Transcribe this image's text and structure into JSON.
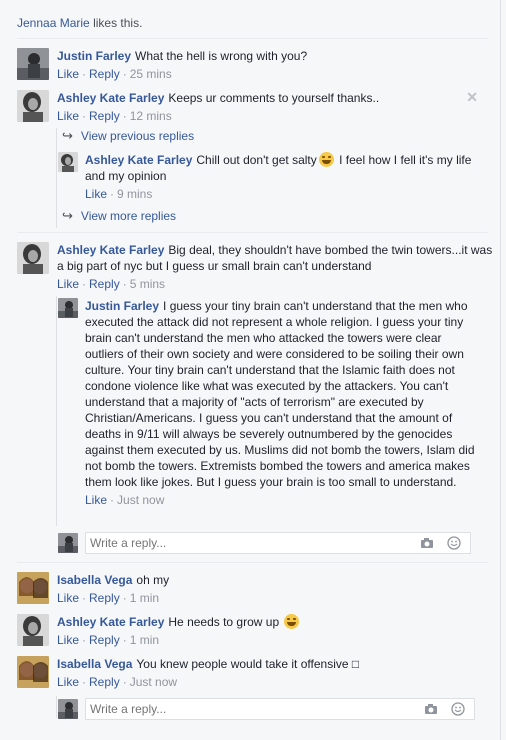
{
  "likes": {
    "name": "Jennaa Marie",
    "suffix": "likes this."
  },
  "actions": {
    "like": "Like",
    "reply": "Reply",
    "dot": "·"
  },
  "links": {
    "view_previous": "View previous replies",
    "view_more": "View more replies"
  },
  "reply_box": {
    "placeholder": "Write a reply..."
  },
  "comments": [
    {
      "author": "Justin Farley",
      "text": "What the hell is wrong with you?",
      "time": "25 mins",
      "avatar": "justin"
    },
    {
      "author": "Ashley Kate Farley",
      "text": "Keeps ur comments to yourself thanks..",
      "time": "12 mins",
      "avatar": "ashley"
    },
    {
      "author": "Ashley Kate Farley",
      "text": "Chill out don't get salty",
      "text2": "I feel how I fell it's my life and my opinion",
      "time": "9 mins",
      "avatar": "ashley",
      "emoji": "grimace-emoji"
    },
    {
      "author": "Ashley Kate Farley",
      "text": "Big deal, they shouldn't have bombed the twin towers...it was a big part of nyc but I guess ur small brain can't understand",
      "time": "5 mins",
      "avatar": "ashley"
    },
    {
      "author": "Justin Farley",
      "text": "I guess your tiny brain can't understand that the men who executed the attack did not represent a whole religion. I guess your tiny brain can't understand the men who attacked the towers were clear outliers of their own society and were considered to be soiling their own culture. Your tiny brain can't understand that the Islamic faith does not condone violence like what was executed by the attackers. You can't understand that a majority of \"acts of terrorism\" are executed by Christian/Americans. I guess you can't understand that the amount of deaths in 9/11 will always be severely outnumbered by the genocides against them executed by us. Muslims did not bomb the towers, Islam did not bomb the towers. Extremists bombed the towers and america makes them look like jokes. But I guess your brain is too small to understand.",
      "time": "Just now",
      "avatar": "justin"
    },
    {
      "author": "Isabella Vega",
      "text": "oh my",
      "time": "1 min",
      "avatar": "isabella"
    },
    {
      "author": "Ashley Kate Farley",
      "text": "He needs to grow up",
      "time": "1 min",
      "avatar": "ashley",
      "emoji": "grimace-emoji"
    },
    {
      "author": "Isabella Vega",
      "text": "You knew people would take it offensive",
      "trail": "□",
      "time": "Just now",
      "avatar": "isabella"
    }
  ],
  "colors": {
    "link": "#365899",
    "meta": "#90949c",
    "background": "#f6f7f9"
  }
}
